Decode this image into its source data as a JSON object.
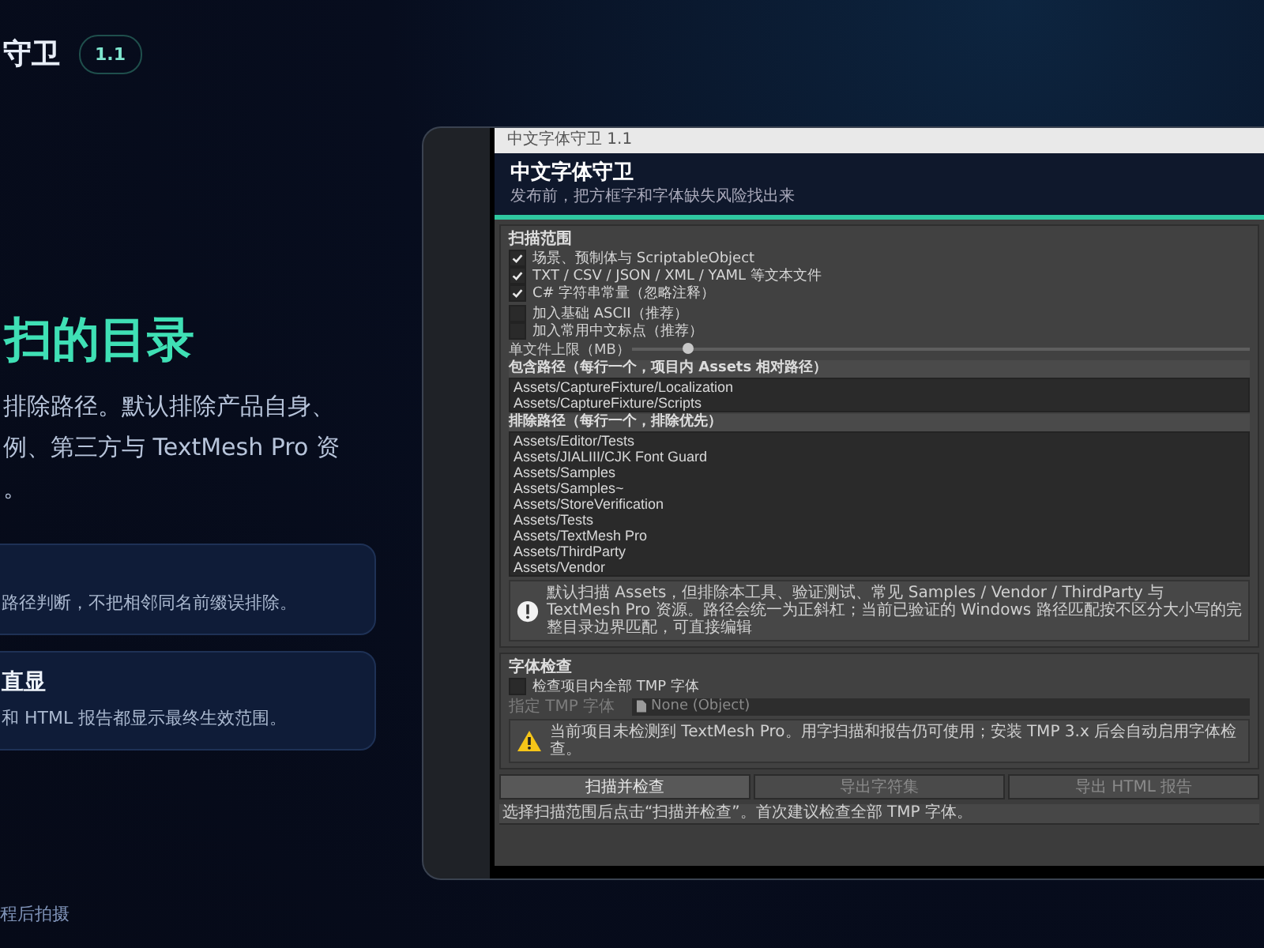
{
  "header": {
    "title": "守卫",
    "badge": "1.1"
  },
  "hero": {
    "heading": "扫的目录",
    "lines": [
      "排除路径。默认排除产品自身、",
      "例、第三方与 TextMesh Pro 资",
      "。"
    ]
  },
  "cards": [
    {
      "text": "路径判断，不把相邻同名前缀误排除。"
    },
    {
      "title": "直显",
      "text": "和 HTML 报告都显示最终生效范围。"
    }
  ],
  "footer": "程后拍摄",
  "editor": {
    "window_title": "中文字体守卫 1.1",
    "title": "中文字体守卫",
    "subtitle": "发布前，把方框字和字体缺失风险找出来",
    "scan": {
      "title": "扫描范围",
      "options": [
        {
          "label": "场景、预制体与 ScriptableObject",
          "checked": true
        },
        {
          "label": "TXT / CSV / JSON / XML / YAML 等文本文件",
          "checked": true
        },
        {
          "label": "C# 字符串常量（忽略注释）",
          "checked": true
        },
        {
          "label": "加入基础 ASCII（推荐）",
          "checked": false
        },
        {
          "label": "加入常用中文标点（推荐）",
          "checked": false
        }
      ],
      "slider": {
        "label": "单文件上限（MB）",
        "level": 0.09
      },
      "include": {
        "label": "包含路径（每行一个，项目内 Assets 相对路径）",
        "paths": [
          "Assets/CaptureFixture/Localization",
          "Assets/CaptureFixture/Scripts"
        ]
      },
      "exclude": {
        "label": "排除路径（每行一个，排除优先）",
        "paths": [
          "Assets/Editor/Tests",
          "Assets/JIALIII/CJK Font Guard",
          "Assets/Samples",
          "Assets/Samples~",
          "Assets/StoreVerification",
          "Assets/Tests",
          "Assets/TextMesh Pro",
          "Assets/ThirdParty",
          "Assets/Vendor"
        ]
      },
      "info": "默认扫描 Assets，但排除本工具、验证测试、常见 Samples / Vendor / ThirdParty 与 TextMesh Pro 资源。路径会统一为正斜杠；当前已验证的 Windows 路径匹配按不区分大小写的完整目录边界匹配，可直接编辑"
    },
    "font_check": {
      "title": "字体检查",
      "option": {
        "label": "检查项目内全部 TMP 字体",
        "checked": false
      },
      "field": {
        "label": "指定 TMP 字体",
        "value": "None (Object)",
        "disabled": true
      },
      "warning": "当前项目未检测到 TextMesh Pro。用字扫描和报告仍可使用；安装 TMP 3.x 后会自动启用字体检查。"
    },
    "buttons": [
      {
        "label": "扫描并检查",
        "disabled": false
      },
      {
        "label": "导出字符集",
        "disabled": true
      },
      {
        "label": "导出 HTML 报告",
        "disabled": true
      }
    ],
    "status": "选择扫描范围后点击“扫描并检查”。首次建议检查全部 TMP 字体。"
  }
}
